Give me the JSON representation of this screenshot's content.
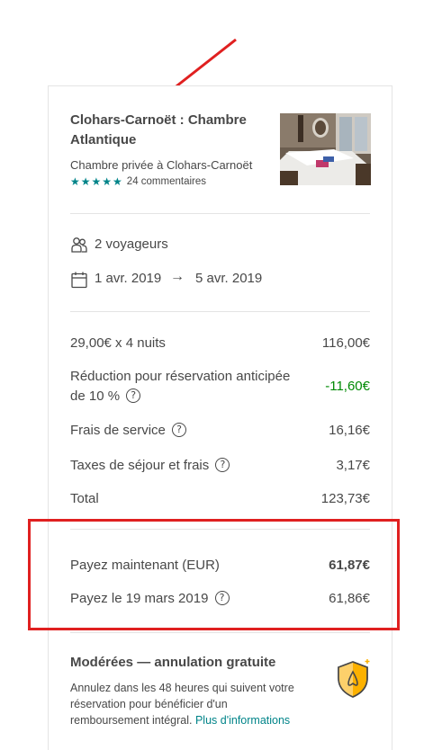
{
  "listing": {
    "title": "Clohars-Carnoët : Chambre Atlantique",
    "subtitle": "Chambre privée à Clohars-Carnoët",
    "stars": "★★★★★",
    "reviews": "24 commentaires"
  },
  "trip": {
    "guests": "2 voyageurs",
    "checkin": "1 avr. 2019",
    "arrow": "→",
    "checkout": "5 avr. 2019"
  },
  "pricing": {
    "nights_label": "29,00€ x 4 nuits",
    "nights_value": "116,00€",
    "discount_label_line1": "Réduction pour réservation anticipée",
    "discount_label_line2": "de 10 %",
    "discount_value": "-11,60€",
    "service_label": "Frais de service",
    "service_value": "16,16€",
    "taxes_label": "Taxes de séjour et frais",
    "taxes_value": "3,17€",
    "total_label": "Total",
    "total_value": "123,73€"
  },
  "payment": {
    "now_label": "Payez maintenant (EUR)",
    "now_value": "61,87€",
    "later_label": "Payez le 19 mars 2019",
    "later_value": "61,86€"
  },
  "cancellation": {
    "title": "Modérées — annulation gratuite",
    "text": "Annulez dans les 48 heures qui suivent votre réservation pour bénéficier d'un remboursement intégral.",
    "link": "Plus d'informations"
  },
  "help_glyph": "?",
  "colors": {
    "accent": "#008489",
    "discount": "#008a05",
    "annotation": "#e02020",
    "shield": "#fcb100"
  }
}
